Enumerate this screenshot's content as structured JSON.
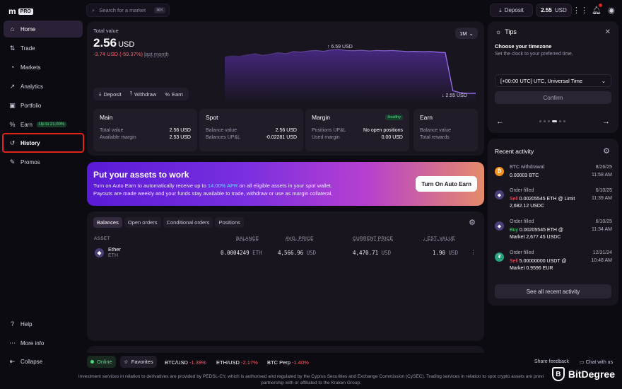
{
  "brand": {
    "logo": "m",
    "tag": "PRO"
  },
  "search": {
    "placeholder": "Search for a market",
    "shortcut": "⌘K"
  },
  "topbar": {
    "deposit_label": "Deposit",
    "balance_value": "2.55",
    "balance_currency": "USD"
  },
  "sidebar": {
    "items": [
      {
        "label": "Home",
        "icon": "home-icon"
      },
      {
        "label": "Trade",
        "icon": "trade-icon"
      },
      {
        "label": "Markets",
        "icon": "markets-icon"
      },
      {
        "label": "Analytics",
        "icon": "analytics-icon"
      },
      {
        "label": "Portfolio",
        "icon": "portfolio-icon"
      },
      {
        "label": "Earn",
        "icon": "earn-icon",
        "badge": "Up to 21.00%"
      },
      {
        "label": "History",
        "icon": "history-icon"
      },
      {
        "label": "Promos",
        "icon": "promos-icon"
      }
    ],
    "bottom": [
      {
        "label": "Help",
        "icon": "help-icon"
      },
      {
        "label": "More info",
        "icon": "more-icon"
      },
      {
        "label": "Collapse",
        "icon": "collapse-icon"
      }
    ]
  },
  "total": {
    "label": "Total value",
    "value": "2.56",
    "currency": "USD",
    "change": "-3.74 USD (-59.37%)",
    "change_period": "last month",
    "period": "1M",
    "actions": [
      "Deposit",
      "Withdraw",
      "Earn"
    ],
    "chart_high": "↑ 6.59 USD",
    "chart_low": "↓ 2.55 USD"
  },
  "chart_data": {
    "type": "area",
    "series": [
      {
        "values": [
          5.9,
          6.0,
          5.95,
          6.1,
          6.2,
          6.05,
          6.15,
          6.3,
          6.2,
          6.4,
          6.35,
          6.45,
          6.5,
          6.42,
          6.55,
          6.59,
          6.5,
          6.48,
          6.52,
          6.45,
          6.5,
          6.47,
          6.5,
          6.45,
          6.4,
          6.42,
          6.38,
          6.4,
          6.35,
          6.3,
          2.8,
          2.6,
          2.55,
          2.56
        ]
      }
    ],
    "ylim": [
      2.55,
      6.59
    ]
  },
  "accounts": [
    {
      "title": "Main",
      "rows": [
        {
          "k": "Total value",
          "v": "2.56 USD"
        },
        {
          "k": "Available margin",
          "v": "2.53 USD"
        }
      ]
    },
    {
      "title": "Spot",
      "rows": [
        {
          "k": "Balance value",
          "v": "2.56 USD"
        },
        {
          "k": "Balances UP&L",
          "v": "-0.02281 USD"
        }
      ]
    },
    {
      "title": "Margin",
      "badge": "Healthy",
      "rows": [
        {
          "k": "Positions UP&L",
          "v": "No open positions"
        },
        {
          "k": "Used margin",
          "v": "0.00 USD"
        }
      ]
    },
    {
      "title": "Earn",
      "rows": [
        {
          "k": "Balance value",
          "v": ""
        },
        {
          "k": "Total rewards",
          "v": ""
        }
      ]
    }
  ],
  "banner": {
    "title": "Put your assets to work",
    "line1_pre": "Turn on Auto Earn to automatically receive up to ",
    "apr": "14.00% APR",
    "line1_post": " on all eligible assets in your spot wallet.",
    "line2": "Payouts are made weekly and your funds stay available to trade, withdraw or use as margin collateral.",
    "cta": "Turn On Auto Earn"
  },
  "balances": {
    "tabs": [
      "Balances",
      "Open orders",
      "Conditional orders",
      "Positions"
    ],
    "headers": {
      "asset": "ASSET",
      "balance": "BALANCE",
      "avg": "AVG. PRICE",
      "current": "CURRENT PRICE",
      "est": "EST. VALUE"
    },
    "rows": [
      {
        "name": "Ether",
        "ticker": "ETH",
        "balance": "0.0004249",
        "balance_unit": "ETH",
        "avg": "4,566.96",
        "avg_unit": "USD",
        "current": "4,470.71",
        "current_unit": "USD",
        "est": "1.90",
        "est_unit": "USD"
      }
    ]
  },
  "tips": {
    "title": "Tips",
    "subtitle": "Choose your timezone",
    "desc": "Set the clock to your preferred time.",
    "timezone": "[+00:00 UTC] UTC, Universal Time",
    "confirm": "Confirm"
  },
  "activity": {
    "title": "Recent activity",
    "items": [
      {
        "title": "BTC withdrawal",
        "line1": "0.00003 BTC",
        "line2": "",
        "date": "8/26/25",
        "time": "11:58 AM",
        "color": "#f7931a",
        "glyph": "₿"
      },
      {
        "title": "Order filled",
        "side": "Sell",
        "line1": " 0.00205545 ETH @ Limit",
        "line2": "2,682.12 USDC",
        "date": "6/10/25",
        "time": "11:39 AM",
        "color": "#4b3f7a",
        "glyph": "◆"
      },
      {
        "title": "Order filled",
        "side": "Buy",
        "line1": " 0.00205545 ETH @",
        "line2": "Market 2,677.45 USDC",
        "date": "6/10/25",
        "time": "11:34 AM",
        "color": "#4b3f7a",
        "glyph": "◆"
      },
      {
        "title": "Order filled",
        "side": "Sell",
        "line1": " 5.00000000 USDT @",
        "line2": "Market 0.9596 EUR",
        "date": "12/31/24",
        "time": "10:48 AM",
        "color": "#26a17b",
        "glyph": "₮"
      }
    ],
    "see_all": "See all recent activity"
  },
  "status": {
    "online": "Online",
    "favorites": "Favorites",
    "tickers": [
      {
        "pair": "BTC/USD",
        "chg": "-1.39%"
      },
      {
        "pair": "ETH/USD",
        "chg": "-2.17%"
      },
      {
        "pair": "BTC Perp",
        "chg": "-1.40%"
      }
    ],
    "share": "Share feedback",
    "chat": "Chat with us"
  },
  "footer": {
    "line1": "Investment services in relation to derivatives are provided by PEDSL-CY, which is authorised and regulated by the Cyprus Securities and Exchange Commission (CySEC). Trading services in relation to spot crypto assets are provi",
    "line2": "partnership with or affiliated to the Kraken Group."
  },
  "watermark": "BitDegree"
}
